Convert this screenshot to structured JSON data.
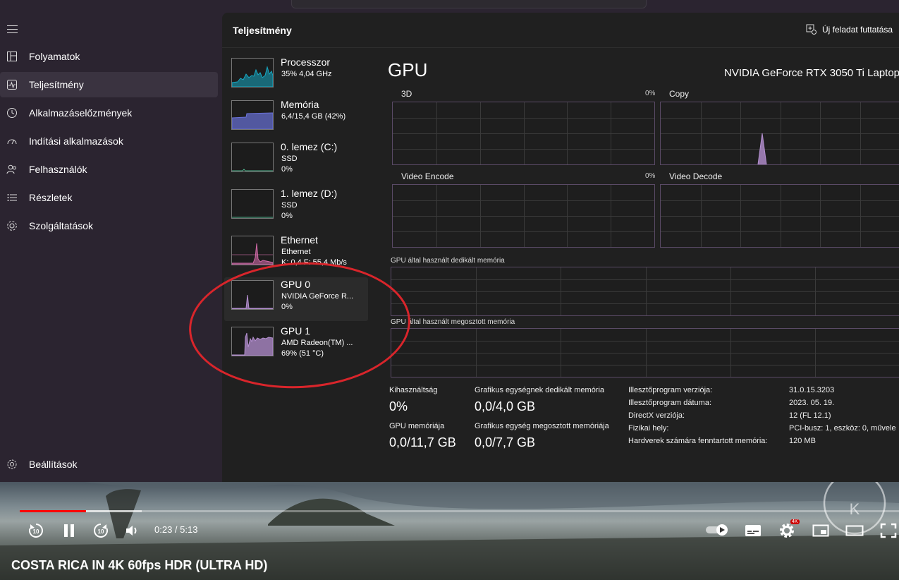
{
  "sidebar": {
    "items": [
      {
        "label": "Folyamatok",
        "icon": "processes-icon"
      },
      {
        "label": "Teljesítmény",
        "icon": "performance-icon",
        "active": true
      },
      {
        "label": "Alkalmazáselőzmények",
        "icon": "history-icon"
      },
      {
        "label": "Indítási alkalmazások",
        "icon": "startup-icon"
      },
      {
        "label": "Felhasználók",
        "icon": "users-icon"
      },
      {
        "label": "Részletek",
        "icon": "details-icon"
      },
      {
        "label": "Szolgáltatások",
        "icon": "services-icon"
      }
    ],
    "settings_label": "Beállítások"
  },
  "header": {
    "title": "Teljesítmény",
    "new_task": "Új feladat futtatása"
  },
  "devices": [
    {
      "name": "Processzor",
      "sub": "35% 4,04 GHz",
      "sub2": "",
      "color": "#17a9c4"
    },
    {
      "name": "Memória",
      "sub": "6,4/15,4 GB (42%)",
      "sub2": "",
      "color": "#6a72d8"
    },
    {
      "name": "0. lemez (C:)",
      "sub": "SSD",
      "sub2": "0%",
      "color": "#4fb28b"
    },
    {
      "name": "1. lemez (D:)",
      "sub": "SSD",
      "sub2": "0%",
      "color": "#4fb28b"
    },
    {
      "name": "Ethernet",
      "sub": "Ethernet",
      "sub2": "K: 0,4 F: 55,4 Mb/s",
      "color": "#d16aa8"
    },
    {
      "name": "GPU 0",
      "sub": "NVIDIA GeForce R...",
      "sub2": "0%",
      "color": "#b48fd0",
      "selected": true
    },
    {
      "name": "GPU 1",
      "sub": "AMD Radeon(TM) ...",
      "sub2": "69% (51 °C)",
      "color": "#b48fd0"
    }
  ],
  "gpu": {
    "title": "GPU",
    "model": "NVIDIA GeForce RTX 3050 Ti Laptop",
    "engines": [
      {
        "label": "3D",
        "pct": "0%"
      },
      {
        "label": "Copy",
        "pct": ""
      },
      {
        "label": "Video Encode",
        "pct": "0%"
      },
      {
        "label": "Video Decode",
        "pct": ""
      }
    ],
    "dedicated_label": "GPU által használt dedikált memória",
    "shared_label": "GPU által használt megosztott memória",
    "stats": {
      "util_label": "Kihasználtság",
      "util_value": "0%",
      "dedicated_label": "Grafikus egységnek dedikált memória",
      "dedicated_value": "0,0/4,0 GB",
      "mem_label": "GPU memóriája",
      "mem_value": "0,0/11,7 GB",
      "shared_label": "Grafikus egység megosztott memóriája",
      "shared_value": "0,0/7,7 GB"
    },
    "info": [
      {
        "k": "Illesztőprogram verziója:",
        "v": "31.0.15.3203"
      },
      {
        "k": "Illesztőprogram dátuma:",
        "v": "2023. 05. 19."
      },
      {
        "k": "DirectX verziója:",
        "v": "12 (FL 12.1)"
      },
      {
        "k": "Fizikai hely:",
        "v": "PCI-busz: 1, eszköz: 0, művele"
      },
      {
        "k": "Hardverek számára fenntartott memória:",
        "v": "120 MB"
      }
    ]
  },
  "player": {
    "time": "0:23 / 5:13",
    "title": "COSTA RICA IN 4K 60fps HDR (ULTRA HD)",
    "quality_badge": "4K",
    "played_fraction": 0.075,
    "buffered_fraction": 0.139,
    "accent": "#ff0000"
  }
}
